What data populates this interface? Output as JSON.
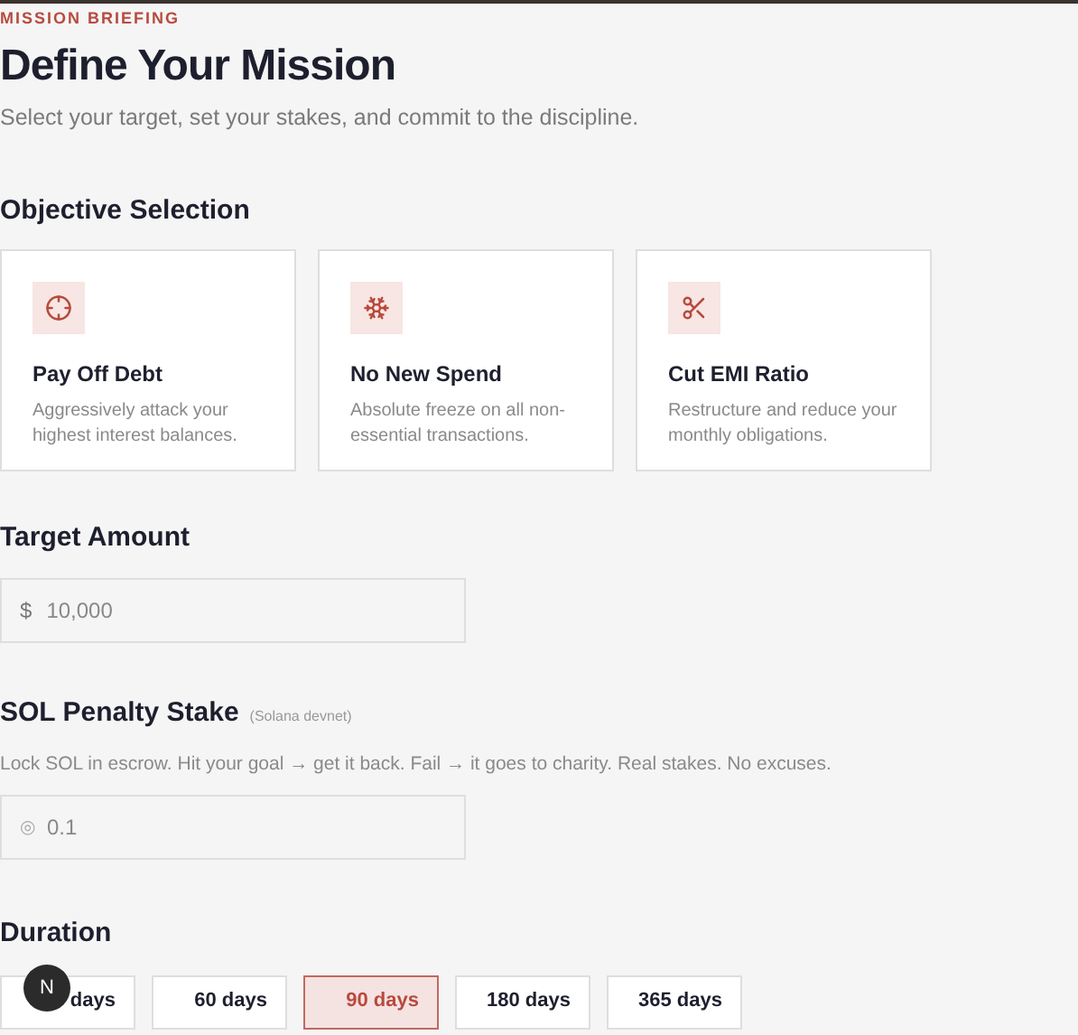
{
  "eyebrow": "MISSION BRIEFING",
  "title": "Define Your Mission",
  "subtitle": "Select your target, set your stakes, and commit to the discipline.",
  "objective": {
    "heading": "Objective Selection",
    "options": [
      {
        "kind": "target",
        "title": "Pay Off Debt",
        "description": "Aggressively attack your highest interest balances.",
        "selected": false
      },
      {
        "kind": "freeze",
        "title": "No New Spend",
        "description": "Absolute freeze on all non-essential transactions.",
        "selected": false
      },
      {
        "kind": "cut",
        "title": "Cut EMI Ratio",
        "description": "Restructure and reduce your monthly obligations.",
        "selected": false
      }
    ]
  },
  "target_amount": {
    "heading": "Target Amount",
    "prefix": "$",
    "value": "10,000"
  },
  "stake": {
    "heading": "SOL Penalty Stake",
    "note": "(Solana devnet)",
    "description": "Lock SOL in escrow. Hit your goal → get it back. Fail → it goes to charity. Real stakes. No excuses.",
    "prefix": "◎",
    "value": "0.1"
  },
  "duration": {
    "heading": "Duration",
    "options": [
      {
        "label": "days",
        "selected": false
      },
      {
        "label": "60 days",
        "selected": false
      },
      {
        "label": "90 days",
        "selected": true
      },
      {
        "label": "180 days",
        "selected": false
      },
      {
        "label": "365 days",
        "selected": false
      }
    ]
  },
  "dev_badge": "N"
}
